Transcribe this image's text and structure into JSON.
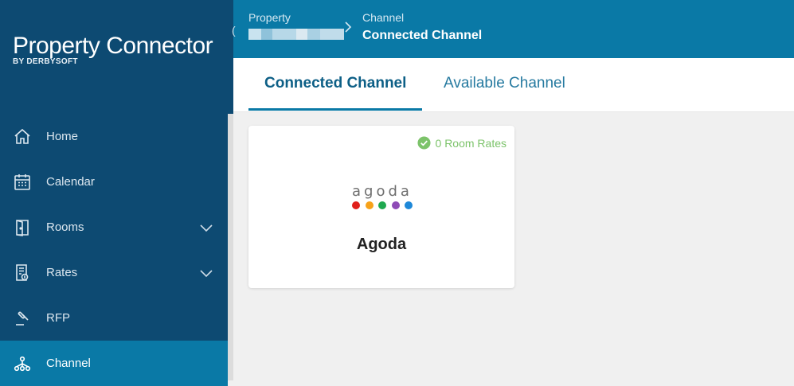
{
  "brand": {
    "name": "Property Connector",
    "sub": "BY DERBYSOFT"
  },
  "sidebar": {
    "items": [
      {
        "label": "Home",
        "icon": "home-icon",
        "expandable": false,
        "active": false
      },
      {
        "label": "Calendar",
        "icon": "calendar-icon",
        "expandable": false,
        "active": false
      },
      {
        "label": "Rooms",
        "icon": "door-icon",
        "expandable": true,
        "active": false
      },
      {
        "label": "Rates",
        "icon": "rates-icon",
        "expandable": true,
        "active": false
      },
      {
        "label": "RFP",
        "icon": "gavel-icon",
        "expandable": false,
        "active": false
      },
      {
        "label": "Channel",
        "icon": "channel-icon",
        "expandable": false,
        "active": true
      }
    ]
  },
  "header": {
    "crumb1_label": "Property",
    "crumb2_label": "Channel",
    "crumb2_title": "Connected Channel"
  },
  "tabs": [
    {
      "label": "Connected Channel",
      "active": true
    },
    {
      "label": "Available Channel",
      "active": false
    }
  ],
  "channels": [
    {
      "name": "Agoda",
      "logo_text": "agoda",
      "status": "0 Room Rates",
      "status_color": "#7cc36a",
      "logo_dot_colors": [
        "#e0201b",
        "#f7a21a",
        "#1fa84f",
        "#8e4bb6",
        "#1e88d8"
      ]
    }
  ],
  "colors": {
    "sidebar": "#0d4a72",
    "accent": "#0a79a6",
    "success": "#7cc36a"
  }
}
